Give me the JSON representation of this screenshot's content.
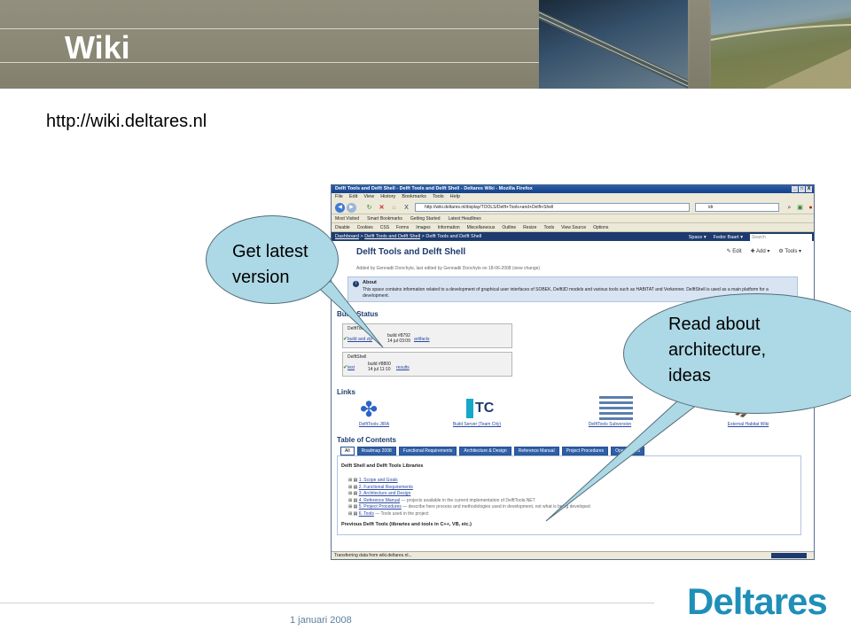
{
  "slide": {
    "title": "Wiki",
    "url": "http://wiki.deltares.nl",
    "footer_date": "1 januari 2008",
    "footer_logo": "Deltares",
    "accent_color": "#1f8fb8"
  },
  "callouts": {
    "left": "Get latest version",
    "left_lines": [
      "Get latest",
      "version"
    ],
    "right_lines": [
      "Read about",
      "architecture,",
      "ideas"
    ],
    "bubble_color": "#add8e6"
  },
  "browser": {
    "window_title": "Delft Tools and Delft Shell - Delft Tools and Delft Shell - Deltares Wiki - Mozilla Firefox",
    "window_buttons": [
      "_",
      "□",
      "X"
    ],
    "menu": [
      "File",
      "Edit",
      "View",
      "History",
      "Bookmarks",
      "Tools",
      "Help"
    ],
    "address": "http://wiki.deltares.nl/display/TOOLS/Delft+Tools+and+Delft+Shell",
    "search_value": "idr",
    "bookmarks": [
      "Disable",
      "Cookies",
      "CSS",
      "Forms",
      "Images",
      "Information",
      "Miscellaneous",
      "Outline",
      "Resize",
      "Tools",
      "View Source",
      "Options"
    ],
    "bookmarks2": [
      "Most Visited",
      "Smart Bookmarks",
      "Getting Started",
      "Latest Headlines"
    ],
    "breadcrumb_parts": [
      "Dashboard",
      "Delft Tools and Delft Shell",
      "Delft Tools and Delft Shell"
    ],
    "conf_right": [
      "Space ▾",
      "Fedor Baart ▾"
    ],
    "search_placeholder": "Search",
    "status_text": "Transferring data from wiki.deltares.nl..."
  },
  "page": {
    "title": "Delft Tools and Delft Shell",
    "meta": "Added by Gennadii Donchyts, last edited by Gennadii Donchyts on 18-06-2008 (view change)",
    "actions": [
      "✎ Edit",
      "✚ Add ▾",
      "⚙ Tools ▾"
    ],
    "about_title": "About",
    "about_text": "This space contains information related to a development of graphical user interfaces of SOBEK, Delft3D models and various tools such as HABITAT and Verkenner. DelftShell is used as a main platform for a development.",
    "build_status_heading": "Build Status",
    "builds": [
      {
        "name": "DelftTools",
        "link": "build and zip",
        "build": "build #8792",
        "date": "14 jul 03:09",
        "result": "artifacts"
      },
      {
        "name": "DelftShell",
        "link": "test",
        "build": "build #8800",
        "date": "14 jul 11:10",
        "result": "results"
      }
    ],
    "links_heading": "Links",
    "links": [
      "DelftTools JIRA",
      "Build Server (Team City)",
      "DelftTools Subversion",
      "External Habitat Wiki"
    ],
    "toc_heading": "Table of Contents",
    "toc_tabs": [
      "All",
      "Roadmap 2008",
      "Functional Requirements",
      "Architecture & Design",
      "Reference Manual",
      "Project Procedures",
      "Open Issues"
    ],
    "toc_section": "Delft Shell and Delft Tools Libraries",
    "toc_items": [
      {
        "link": "1. Scope and Goals",
        "desc": ""
      },
      {
        "link": "2. Functional Requirements",
        "desc": ""
      },
      {
        "link": "3. Architecture and Design",
        "desc": ""
      },
      {
        "link": "4. Reference Manual",
        "desc": " — projects available in the current implementation of DelftTools.NET"
      },
      {
        "link": "5. Project Procedures",
        "desc": " — describe here process and methodologies used in development, not what is being developed"
      },
      {
        "link": "6. Tools",
        "desc": " — Tools used in the project"
      }
    ],
    "toc_prev": "Previous Delft Tools (libraries and tools in C++, VB, etc.)"
  }
}
